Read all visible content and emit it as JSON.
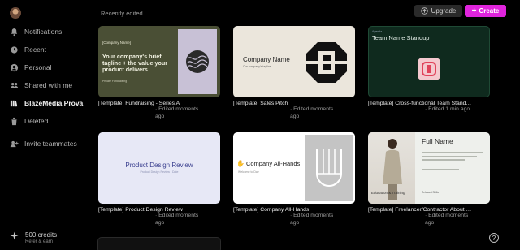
{
  "sidebar": {
    "items": [
      {
        "label": "Notifications",
        "icon": "bell-icon"
      },
      {
        "label": "Recent",
        "icon": "clock-icon"
      },
      {
        "label": "Personal",
        "icon": "user-icon"
      },
      {
        "label": "Shared with me",
        "icon": "users-icon"
      },
      {
        "label": "BlazeMedia Prova",
        "icon": "library-icon",
        "active": true
      },
      {
        "label": "Deleted",
        "icon": "trash-icon"
      },
      {
        "label": "Invite teammates",
        "icon": "user-plus-icon"
      }
    ],
    "credits": {
      "label": "500 credits",
      "sub": "Refer & earn",
      "icon": "sparkle-icon"
    }
  },
  "header": {
    "section_title": "Recently edited",
    "upgrade_label": "Upgrade",
    "create_label": "Create"
  },
  "help_label": "?",
  "colors": {
    "accent": "#e024dd",
    "background": "#000000"
  },
  "cards": [
    {
      "title": "[Template] Fundraising - Series A",
      "meta1": "· Edited moments",
      "meta2": "ago",
      "thumb": {
        "small": "[Company Name]",
        "big": "Your company's brief tagline + the value your product delivers",
        "tiny": "Private Fundraising"
      }
    },
    {
      "title": "[Template] Sales Pitch",
      "meta1": "· Edited moments",
      "meta2": "ago",
      "thumb": {
        "name": "Company Name",
        "tag": "Our company's tagline"
      }
    },
    {
      "title": "[Template] Cross-functional Team Stand…",
      "meta1": "· Edited 1 min ago",
      "meta2": "",
      "thumb": {
        "small": "Agenda",
        "name": "Team Name Standup"
      }
    },
    {
      "title": "[Template] Product Design Review",
      "meta1": "· Edited moments",
      "meta2": "ago",
      "thumb": {
        "name": "Product Design Review",
        "tag": "Product Design Review · Date"
      }
    },
    {
      "title": "[Template] Company All-Hands",
      "meta1": "· Edited moments",
      "meta2": "ago",
      "thumb": {
        "name": "Company All-Hands",
        "tag": "Welcome to Day"
      }
    },
    {
      "title": "[Template] Freelancer/Contractor About …",
      "meta1": "· Edited moments",
      "meta2": "ago",
      "thumb": {
        "name": "Full Name",
        "edu": "Education & Training",
        "skill": "Relevant Skills"
      }
    }
  ]
}
